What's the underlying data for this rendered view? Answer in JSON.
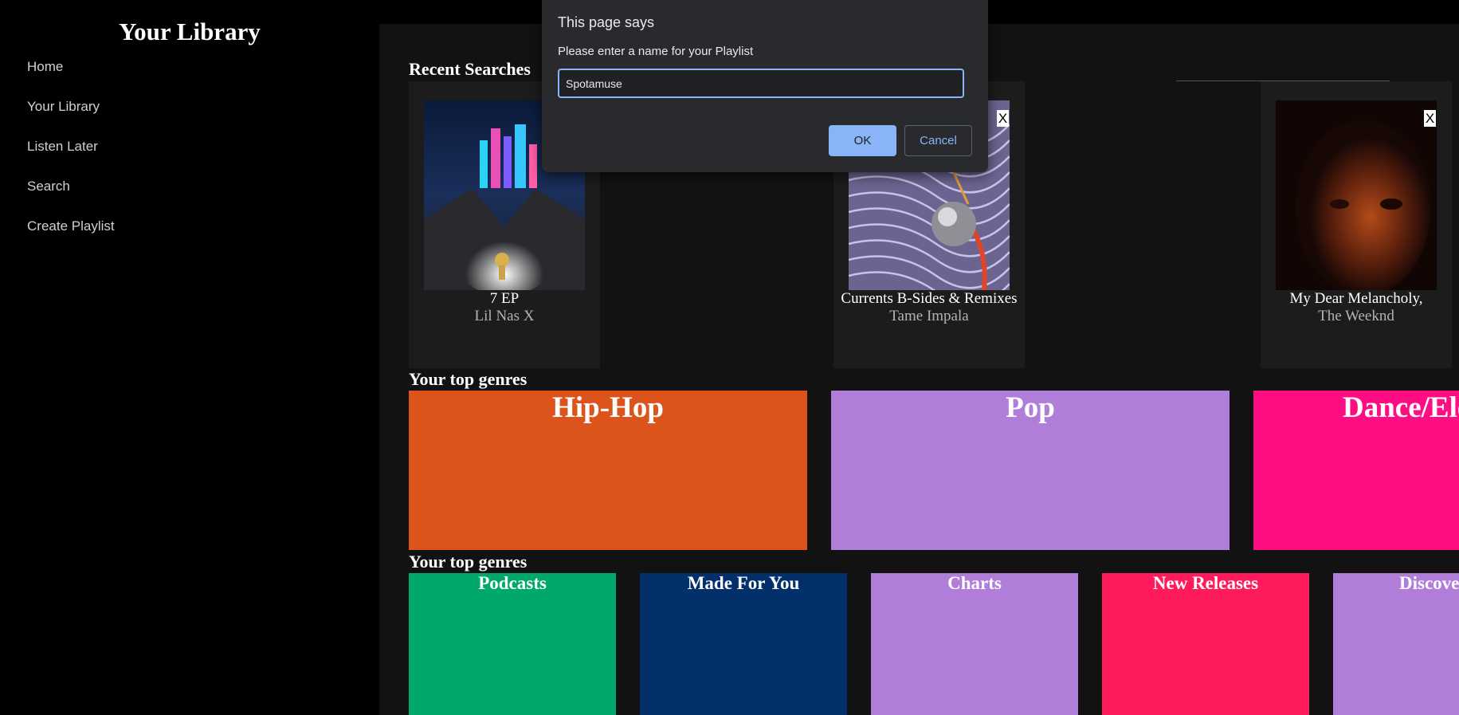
{
  "sidebar": {
    "title": "Your Library",
    "items": [
      {
        "label": "Home"
      },
      {
        "label": "Your Library"
      },
      {
        "label": "Listen Later"
      },
      {
        "label": "Search"
      },
      {
        "label": "Create Playlist"
      }
    ]
  },
  "main": {
    "recent_title": "Recent Searches",
    "recent": [
      {
        "name": "7 EP",
        "artist": "Lil Nas X"
      },
      {
        "name": "Currents B-Sides & Remixes",
        "artist": "Tame Impala",
        "close": "X"
      },
      {
        "name": "My Dear Melancholy,",
        "artist": "The Weeknd",
        "close": "X"
      }
    ],
    "genres_title": "Your top genres",
    "genres": [
      {
        "label": "Hip-Hop",
        "color": "#dc541b"
      },
      {
        "label": "Pop",
        "color": "#b07ed9"
      },
      {
        "label": "Dance/Electronic",
        "color": "#ff0d83"
      }
    ],
    "categories_title": "Your top genres",
    "categories": [
      {
        "label": "Podcasts",
        "color": "#00a86b"
      },
      {
        "label": "Made For You",
        "color": "#03306b"
      },
      {
        "label": "Charts",
        "color": "#b07ed9"
      },
      {
        "label": "New Releases",
        "color": "#ff1a5b"
      },
      {
        "label": "Discover",
        "color": "#b07ed9"
      }
    ]
  },
  "dialog": {
    "title": "This page says",
    "message": "Please enter a name for your Playlist",
    "input_value": "Spotamuse",
    "ok_label": "OK",
    "cancel_label": "Cancel"
  }
}
